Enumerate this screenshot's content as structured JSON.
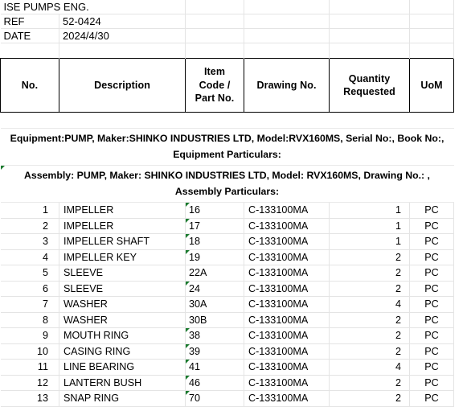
{
  "document": {
    "company": "ISE PUMPS ENG.",
    "meta": [
      {
        "label": "REF",
        "value": "52-0424"
      },
      {
        "label": "DATE",
        "value": "2024/4/30"
      }
    ]
  },
  "table": {
    "columns": [
      {
        "key": "no",
        "label": "No."
      },
      {
        "key": "desc",
        "label": "Description"
      },
      {
        "key": "item",
        "label": "Item Code / Part No."
      },
      {
        "key": "draw",
        "label": "Drawing No."
      },
      {
        "key": "qty",
        "label": "Quantity Requested"
      },
      {
        "key": "uom",
        "label": "UoM"
      }
    ],
    "header_lines": {
      "no": "No.",
      "desc": "Description",
      "item_l1": "Item",
      "item_l2": "Code /",
      "item_l3": "Part No.",
      "draw": "Drawing No.",
      "qty_l1": "Quantity",
      "qty_l2": "Requested",
      "uom": "UoM"
    },
    "sections": [
      {
        "id": "equipment",
        "text": "Equipment:PUMP, Maker:SHINKO INDUSTRIES LTD, Model:RVX160MS, Serial No:, Book No:, Equipment Particulars:",
        "error_flag": false
      },
      {
        "id": "assembly",
        "text": "Assembly: PUMP, Maker: SHINKO INDUSTRIES LTD, Model: RVX160MS, Drawing No.: , Assembly Particulars:",
        "error_flag": true
      }
    ],
    "rows": [
      {
        "no": "1",
        "desc": "IMPELLER",
        "item": "16",
        "draw": "C-133100MA",
        "qty": "1",
        "uom": "PC",
        "item_flag": true
      },
      {
        "no": "2",
        "desc": "IMPELLER",
        "item": "17",
        "draw": "C-133100MA",
        "qty": "1",
        "uom": "PC",
        "item_flag": true
      },
      {
        "no": "3",
        "desc": "IMPELLER SHAFT",
        "item": "18",
        "draw": "C-133100MA",
        "qty": "1",
        "uom": "PC",
        "item_flag": true
      },
      {
        "no": "4",
        "desc": "IMPELLER KEY",
        "item": "19",
        "draw": "C-133100MA",
        "qty": "2",
        "uom": "PC",
        "item_flag": true
      },
      {
        "no": "5",
        "desc": "SLEEVE",
        "item": "22A",
        "draw": "C-133100MA",
        "qty": "2",
        "uom": "PC",
        "item_flag": false
      },
      {
        "no": "6",
        "desc": "SLEEVE",
        "item": "24",
        "draw": "C-133100MA",
        "qty": "2",
        "uom": "PC",
        "item_flag": true
      },
      {
        "no": "7",
        "desc": "WASHER",
        "item": "30A",
        "draw": "C-133100MA",
        "qty": "4",
        "uom": "PC",
        "item_flag": false
      },
      {
        "no": "8",
        "desc": "WASHER",
        "item": "30B",
        "draw": "C-133100MA",
        "qty": "2",
        "uom": "PC",
        "item_flag": false
      },
      {
        "no": "9",
        "desc": "MOUTH RING",
        "item": "38",
        "draw": "C-133100MA",
        "qty": "2",
        "uom": "PC",
        "item_flag": true
      },
      {
        "no": "10",
        "desc": "CASING RING",
        "item": "39",
        "draw": "C-133100MA",
        "qty": "2",
        "uom": "PC",
        "item_flag": true
      },
      {
        "no": "11",
        "desc": "LINE BEARING",
        "item": "41",
        "draw": "C-133100MA",
        "qty": "4",
        "uom": "PC",
        "item_flag": true
      },
      {
        "no": "12",
        "desc": "LANTERN BUSH",
        "item": "46",
        "draw": "C-133100MA",
        "qty": "2",
        "uom": "PC",
        "item_flag": true
      },
      {
        "no": "13",
        "desc": "SNAP RING",
        "item": "70",
        "draw": "C-133100MA",
        "qty": "2",
        "uom": "PC",
        "item_flag": true
      }
    ]
  },
  "colors": {
    "grid_line": "#e4e4e4",
    "header_border": "#000000",
    "error_flag_green": "#1a7a2e",
    "text": "#000000",
    "background": "#ffffff"
  }
}
